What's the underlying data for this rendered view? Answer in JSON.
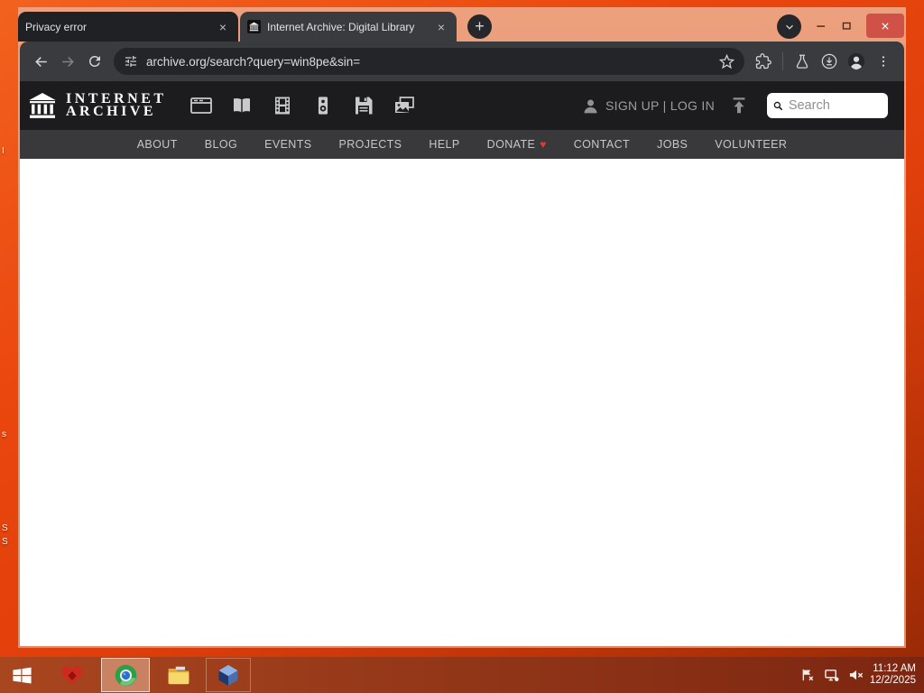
{
  "browser": {
    "tab1": {
      "title": "Privacy error"
    },
    "tab2": {
      "title": "Internet Archive: Digital Library"
    },
    "new_tab_glyph": "+",
    "close_glyph": "×",
    "url": "archive.org/search?query=win8pe&sin="
  },
  "ia": {
    "logo_line1": "INTERNET",
    "logo_line2": "ARCHIVE",
    "auth": "SIGN UP | LOG IN",
    "search_placeholder": "Search",
    "nav": [
      "ABOUT",
      "BLOG",
      "EVENTS",
      "PROJECTS",
      "HELP",
      "DONATE",
      "CONTACT",
      "JOBS",
      "VOLUNTEER"
    ],
    "donate_heart": "♥"
  },
  "taskbar": {
    "time": "11:12 AM",
    "date": "12/2/2025"
  },
  "desktop": {
    "fragments": [
      "I",
      "s",
      "S",
      "S"
    ]
  },
  "colors": {
    "desktop_orange": "#e8430b",
    "frame_salmon": "#e49476",
    "taskbar_red_left": "#a8461f",
    "taskbar_red_right": "#7c2611",
    "toolbar_gray": "#3a3b3f",
    "close_button_red": "#d05148",
    "donate_heart_red": "#e23b2e",
    "search_box_white": "#ffffff"
  }
}
